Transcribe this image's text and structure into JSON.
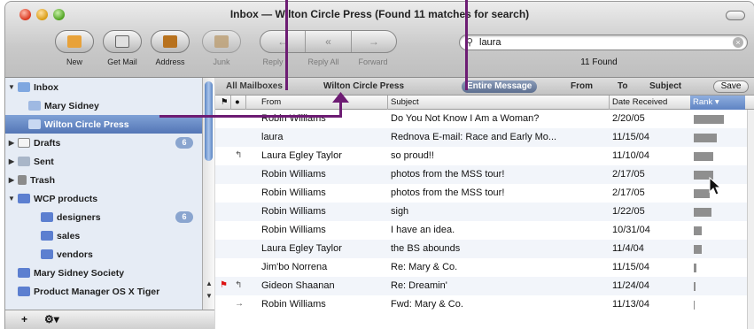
{
  "window": {
    "title": "Inbox — Wilton Circle Press (Found 11 matches for search)"
  },
  "toolbar": {
    "new": "New",
    "get_mail": "Get Mail",
    "address": "Address",
    "junk": "Junk",
    "reply": "Reply",
    "reply_all": "Reply All",
    "forward": "Forward"
  },
  "search": {
    "value": "laura",
    "found": "11 Found"
  },
  "sidebar": {
    "inbox": "Inbox",
    "mary_sidney": "Mary Sidney",
    "wilton": "Wilton Circle Press",
    "drafts": "Drafts",
    "drafts_badge": "6",
    "sent": "Sent",
    "trash": "Trash",
    "wcp_products": "WCP products",
    "designers": "designers",
    "designers_badge": "6",
    "sales": "sales",
    "vendors": "vendors",
    "mss": "Mary Sidney Society",
    "pm": "Product Manager OS X Tiger"
  },
  "filters": {
    "all_mailboxes": "All Mailboxes",
    "wilton": "Wilton Circle Press",
    "entire_message": "Entire Message",
    "from": "From",
    "to": "To",
    "subject": "Subject",
    "save": "Save"
  },
  "columns": {
    "from": "From",
    "subject": "Subject",
    "date": "Date Received",
    "rank": "Rank"
  },
  "messages": [
    {
      "from": "Robin Williams",
      "subject": "Do You Not Know I Am a Woman?",
      "date": "2/20/05",
      "rank": 0.95,
      "status": "",
      "flag": false
    },
    {
      "from": "laura",
      "subject": "Rednova E-mail: Race and Early Mo...",
      "date": "11/15/04",
      "rank": 0.72,
      "status": "",
      "flag": false
    },
    {
      "from": "Laura Egley Taylor",
      "subject": "so proud!!",
      "date": "11/10/04",
      "rank": 0.62,
      "status": "↰",
      "flag": false
    },
    {
      "from": "Robin Williams",
      "subject": "photos from the MSS tour!",
      "date": "2/17/05",
      "rank": 0.6,
      "status": "",
      "flag": false
    },
    {
      "from": "Robin Williams",
      "subject": "photos from the MSS tour!",
      "date": "2/17/05",
      "rank": 0.5,
      "status": "",
      "flag": false
    },
    {
      "from": "Robin Williams",
      "subject": "sigh",
      "date": "1/22/05",
      "rank": 0.55,
      "status": "",
      "flag": false
    },
    {
      "from": "Robin Williams",
      "subject": "I have an idea.",
      "date": "10/31/04",
      "rank": 0.25,
      "status": "",
      "flag": false
    },
    {
      "from": "Laura Egley Taylor",
      "subject": "the BS abounds",
      "date": "11/4/04",
      "rank": 0.25,
      "status": "",
      "flag": false
    },
    {
      "from": "Jim'bo Norrena",
      "subject": "Re: Mary & Co.",
      "date": "11/15/04",
      "rank": 0.08,
      "status": "",
      "flag": false
    },
    {
      "from": "Gideon Shaanan",
      "subject": "Re: Dreamin'",
      "date": "11/24/04",
      "rank": 0.06,
      "status": "↰",
      "flag": true
    },
    {
      "from": "Robin Williams",
      "subject": "Fwd: Mary & Co.",
      "date": "11/13/04",
      "rank": 0.04,
      "status": "→",
      "flag": false
    }
  ],
  "colors": {
    "guide": "#6d1c73",
    "selection": "#5476b6"
  }
}
